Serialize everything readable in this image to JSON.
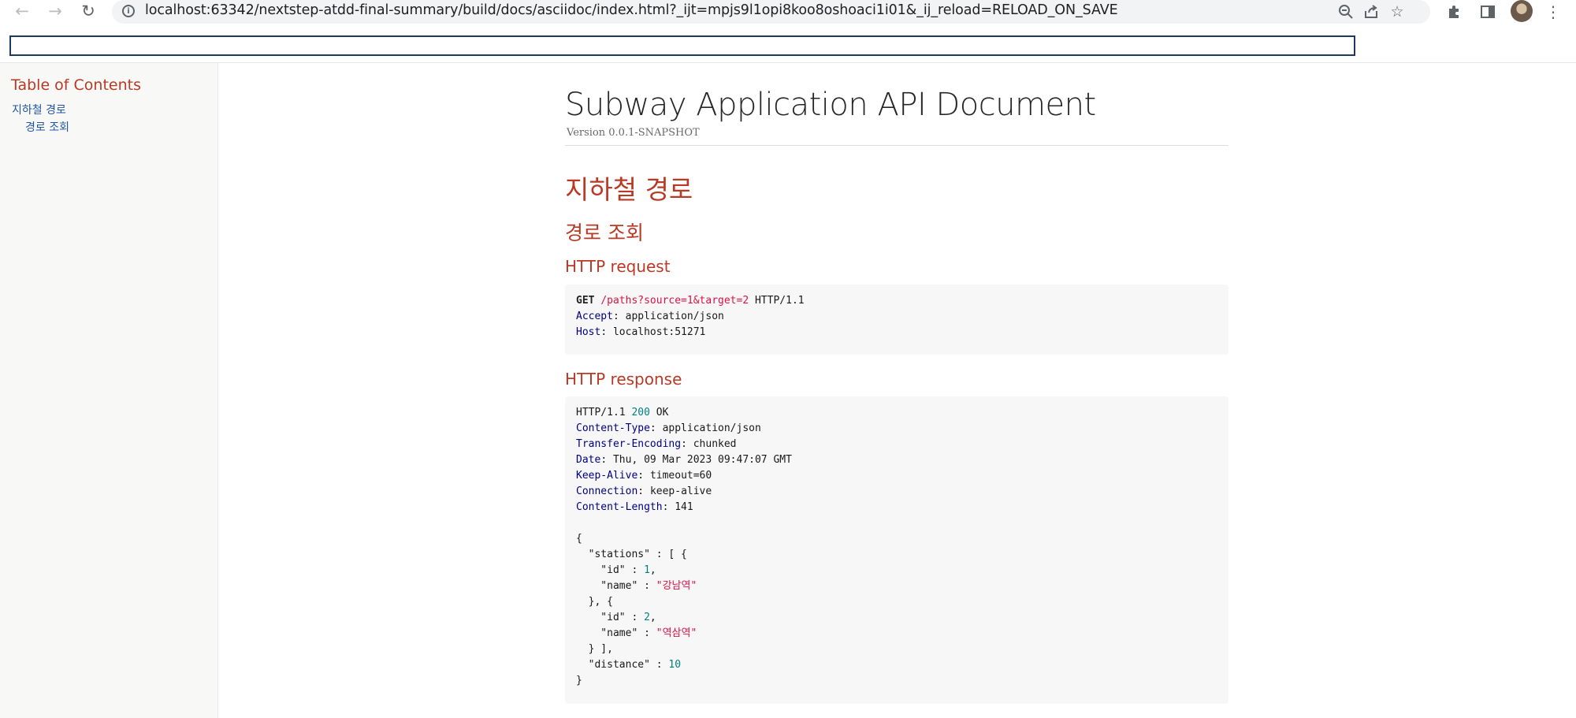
{
  "browser": {
    "url": "localhost:63342/nextstep-atdd-final-summary/build/docs/asciidoc/index.html?_ijt=mpjs9l1opi8koo8oshoaci1i01&_ij_reload=RELOAD_ON_SAVE",
    "icons": {
      "back": "back-arrow-icon",
      "forward": "forward-arrow-icon",
      "reload": "reload-icon",
      "site_info": "info-icon",
      "zoom": "zoom-out-icon",
      "share": "share-icon",
      "bookmark": "star-icon",
      "extensions": "puzzle-icon",
      "side_panel": "side-panel-icon",
      "menu": "kebab-menu-icon"
    }
  },
  "toc": {
    "title": "Table of Contents",
    "items": [
      {
        "label": "지하철 경로",
        "level": 1
      },
      {
        "label": "경로 조회",
        "level": 2
      }
    ]
  },
  "doc": {
    "title": "Subway Application API Document",
    "version": "Version 0.0.1-SNAPSHOT",
    "section": "지하철 경로",
    "subsection": "경로 조회",
    "request_heading": "HTTP request",
    "response_heading": "HTTP response",
    "request": {
      "method": "GET",
      "path": "/paths?source=1&target=2",
      "protocol": "HTTP/1.1",
      "headers": [
        {
          "name": "Accept",
          "value": "application/json"
        },
        {
          "name": "Host",
          "value": "localhost:51271"
        }
      ]
    },
    "response": {
      "protocol": "HTTP/1.1",
      "status_code": "200",
      "status_text": "OK",
      "headers": [
        {
          "name": "Content-Type",
          "value": "application/json"
        },
        {
          "name": "Transfer-Encoding",
          "value": "chunked"
        },
        {
          "name": "Date",
          "value": "Thu, 09 Mar 2023 09:47:07 GMT"
        },
        {
          "name": "Keep-Alive",
          "value": "timeout=60"
        },
        {
          "name": "Connection",
          "value": "keep-alive"
        },
        {
          "name": "Content-Length",
          "value": "141"
        }
      ],
      "body": {
        "stations": [
          {
            "id": "1",
            "name": "\"강남역\""
          },
          {
            "id": "2",
            "name": "\"역삼역\""
          }
        ],
        "distance": "10"
      }
    }
  },
  "colors": {
    "heading": "#ba3925",
    "link": "#2156a5",
    "code_bg": "#f7f7f8"
  }
}
